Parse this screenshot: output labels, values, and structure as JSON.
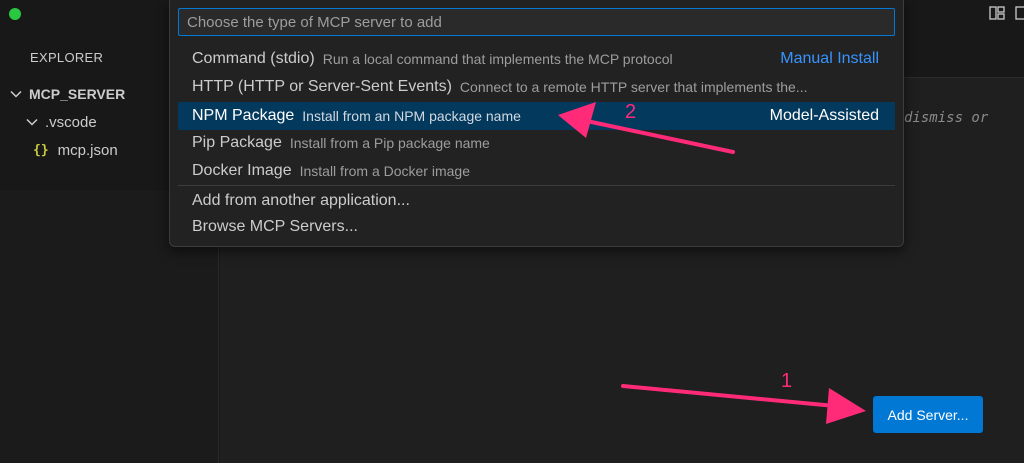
{
  "colors": {
    "accent": "#0078d4",
    "selection": "#04395e",
    "annotation": "#ff2a78",
    "link": "#3794ff",
    "json_icon": "#cbcb41"
  },
  "sidebar": {
    "header": "EXPLORER",
    "tree": [
      {
        "label": "MCP_SERVER",
        "icon": "chevron-down-icon"
      },
      {
        "label": ".vscode",
        "icon": "chevron-down-icon"
      },
      {
        "label": "mcp.json",
        "icon": "json-braces-icon",
        "icon_text": "{}"
      }
    ]
  },
  "editor": {
    "hint": "dismiss or"
  },
  "quickpick": {
    "placeholder": "Choose the type of MCP server to add",
    "items": [
      {
        "label": "Command (stdio)",
        "description": "Run a local command that implements the MCP protocol",
        "right": "Manual Install"
      },
      {
        "label": "HTTP (HTTP or Server-Sent Events)",
        "description": "Connect to a remote HTTP server that implements the...",
        "right": ""
      },
      {
        "label": "NPM Package",
        "description": "Install from an NPM package name",
        "right": "Model-Assisted"
      },
      {
        "label": "Pip Package",
        "description": "Install from a Pip package name",
        "right": ""
      },
      {
        "label": "Docker Image",
        "description": "Install from a Docker image",
        "right": ""
      },
      {
        "label": "Add from another application...",
        "description": "",
        "right": ""
      },
      {
        "label": "Browse MCP Servers...",
        "description": "",
        "right": ""
      }
    ]
  },
  "add_server_button": "Add Server...",
  "annotations": {
    "step1": "1",
    "step2": "2"
  }
}
